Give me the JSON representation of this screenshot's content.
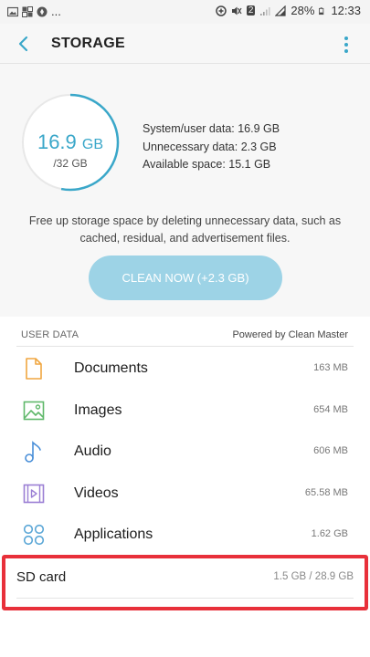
{
  "status_bar": {
    "left_text": "...",
    "sim_badge": "2",
    "battery_percent": "28%",
    "time": "12:33"
  },
  "app_bar": {
    "title": "STORAGE",
    "back_icon": "back-arrow-icon",
    "more_icon": "more-vertical-icon"
  },
  "summary": {
    "used_value": "16.9",
    "used_unit": "GB",
    "total": "/32 GB",
    "used_fraction": 0.53,
    "stats": [
      "System/user data: 16.9 GB",
      "Unnecessary data: 2.3 GB",
      "Available space: 15.1 GB"
    ],
    "description": "Free up storage space by deleting unnecessary data, such as cached, residual, and advertisement files.",
    "clean_button": "CLEAN NOW (+2.3 GB)"
  },
  "user_data": {
    "title": "USER DATA",
    "powered_by": "Powered by Clean Master",
    "items": [
      {
        "label": "Documents",
        "size": "163 MB",
        "icon": "document-icon"
      },
      {
        "label": "Images",
        "size": "654 MB",
        "icon": "image-icon"
      },
      {
        "label": "Audio",
        "size": "606 MB",
        "icon": "music-note-icon"
      },
      {
        "label": "Videos",
        "size": "65.58 MB",
        "icon": "video-icon"
      },
      {
        "label": "Applications",
        "size": "1.62 GB",
        "icon": "apps-icon"
      }
    ]
  },
  "sd_card": {
    "label": "SD card",
    "usage": "1.5 GB / 28.9 GB"
  },
  "colors": {
    "accent": "#3aa7c9",
    "button": "#9dd3e6",
    "document": "#f0a640",
    "image": "#5fb86a",
    "audio": "#4a8fd8",
    "video": "#9b7fd4",
    "apps": "#5aa6d6",
    "highlight": "#e8303a"
  }
}
